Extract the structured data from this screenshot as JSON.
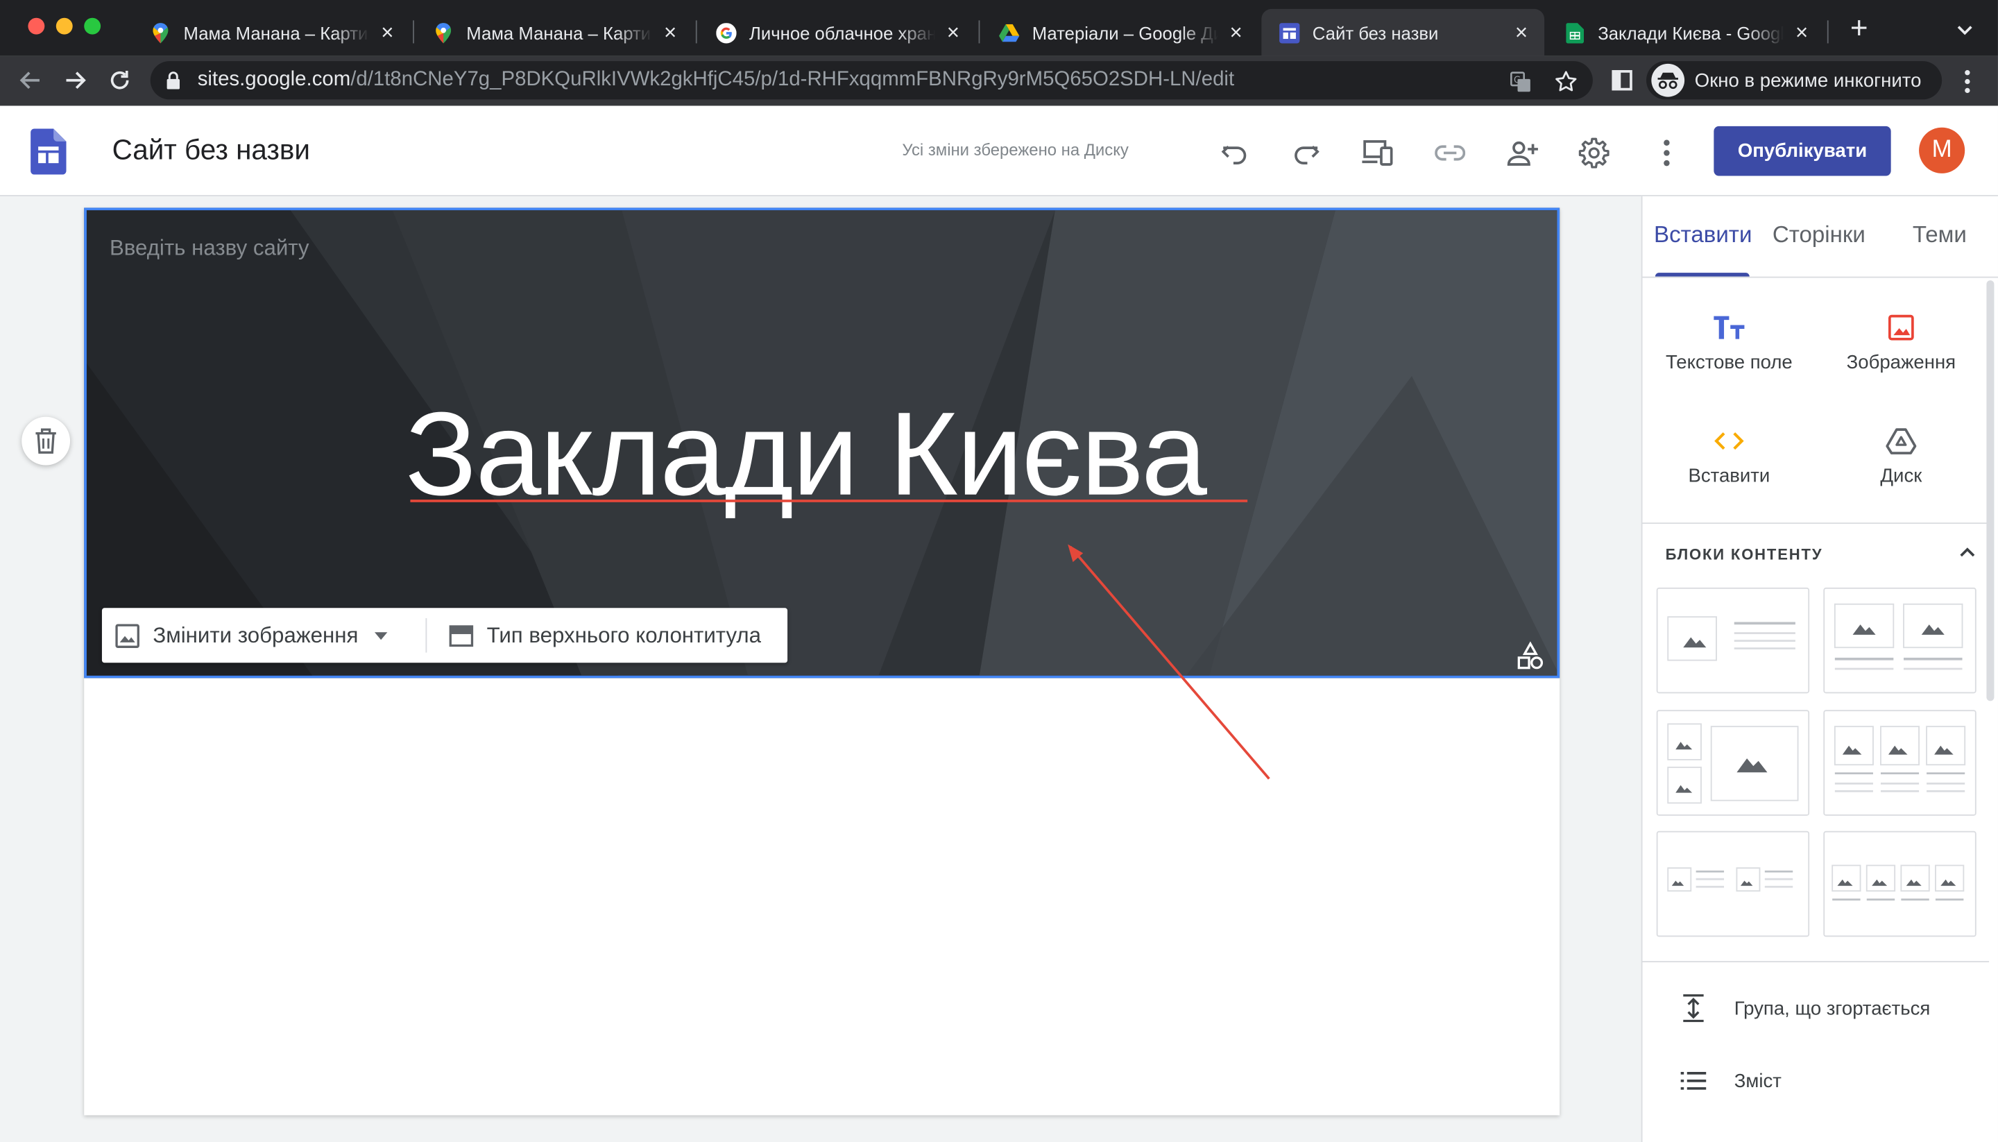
{
  "browser": {
    "tabs": [
      {
        "title": "Мама Манана – Карти Google",
        "favicon": "google-maps-icon"
      },
      {
        "title": "Мама Манана – Карти Google",
        "favicon": "google-maps-icon"
      },
      {
        "title": "Личное облачное хранилище",
        "favicon": "google-g-icon"
      },
      {
        "title": "Матеріали – Google Диск",
        "favicon": "google-drive-icon"
      },
      {
        "title": "Сайт без назви",
        "favicon": "google-sites-icon",
        "active": true
      },
      {
        "title": "Заклади Києва - Google Таблиці",
        "favicon": "google-sheets-icon"
      }
    ],
    "url_host": "sites.google.com",
    "url_path": "/d/1t8nCNeY7g_P8DKQuRlkIVWk2gkHfjC45/p/1d-RHFxqqmmFBNRgRy9rM5Q65O2SDH-LN/edit",
    "incognito_label": "Окно в режиме инкогнито"
  },
  "sites": {
    "doc_title": "Сайт без назви",
    "save_status": "Усі зміни збережено на Диску",
    "publish_label": "Опублікувати",
    "avatar_letter": "M",
    "brand_color": "#3c4ba6"
  },
  "banner": {
    "site_name_placeholder": "Введіть назву сайту",
    "title": "Заклади Києва",
    "change_image_label": "Змінити зображення",
    "header_type_label": "Тип верхнього колонтитула"
  },
  "panel": {
    "tabs": [
      "Вставити",
      "Сторінки",
      "Теми"
    ],
    "insert_items": [
      "Текстове поле",
      "Зображення",
      "Вставити",
      "Диск"
    ],
    "content_blocks_title": "БЛОКИ КОНТЕНТУ",
    "extra_items": [
      "Група, що згортається",
      "Зміст"
    ]
  }
}
